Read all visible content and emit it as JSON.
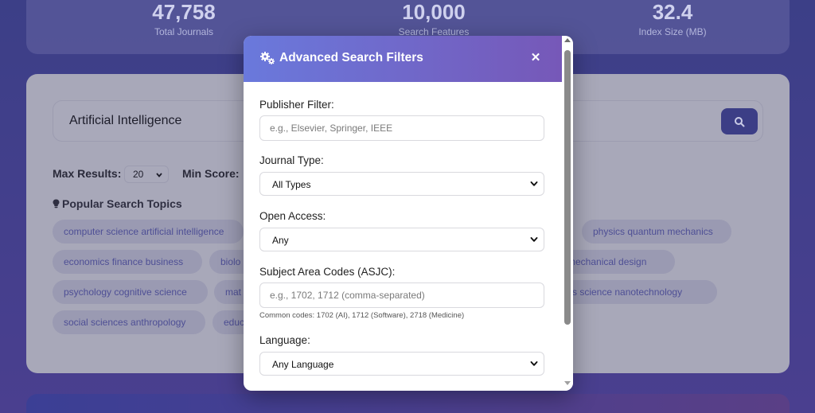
{
  "stats": [
    {
      "value": "47,758",
      "label": "Total Journals"
    },
    {
      "value": "10,000",
      "label": "Search Features"
    },
    {
      "value": "32.4",
      "label": "Index Size (MB)"
    }
  ],
  "search": {
    "query": "Artificial Intelligence",
    "max_results_label": "Max Results:",
    "max_results_value": "20",
    "min_score_label": "Min Score:",
    "popular_heading": "Popular Search Topics"
  },
  "topics": [
    "computer science artificial intelligence",
    "physics quantum mechanics",
    "economics finance business",
    "biolo",
    "g mechanical design",
    "psychology cognitive science",
    "mat",
    "rials science nanotechnology",
    "social sciences anthropology",
    "educ"
  ],
  "modal": {
    "title": "Advanced Search Filters",
    "close_symbol": "✕",
    "publisher_label": "Publisher Filter:",
    "publisher_placeholder": "e.g., Elsevier, Springer, IEEE",
    "journal_type_label": "Journal Type:",
    "journal_type_value": "All Types",
    "open_access_label": "Open Access:",
    "open_access_value": "Any",
    "asjc_label": "Subject Area Codes (ASJC):",
    "asjc_placeholder": "e.g., 1702, 1712 (comma-separated)",
    "asjc_hint": "Common codes: 1702 (AI), 1712 (Software), 2718 (Medicine)",
    "language_label": "Language:",
    "language_value": "Any Language"
  },
  "icons": {
    "title_icon": "cogs-icon",
    "search_icon": "search-icon",
    "popular_icon": "lightbulb-icon",
    "select_icon": "chevron-down-icon"
  },
  "colors": {
    "header_start": "#6a79dc",
    "header_end": "#7658b8",
    "accent": "#3c3e86"
  }
}
